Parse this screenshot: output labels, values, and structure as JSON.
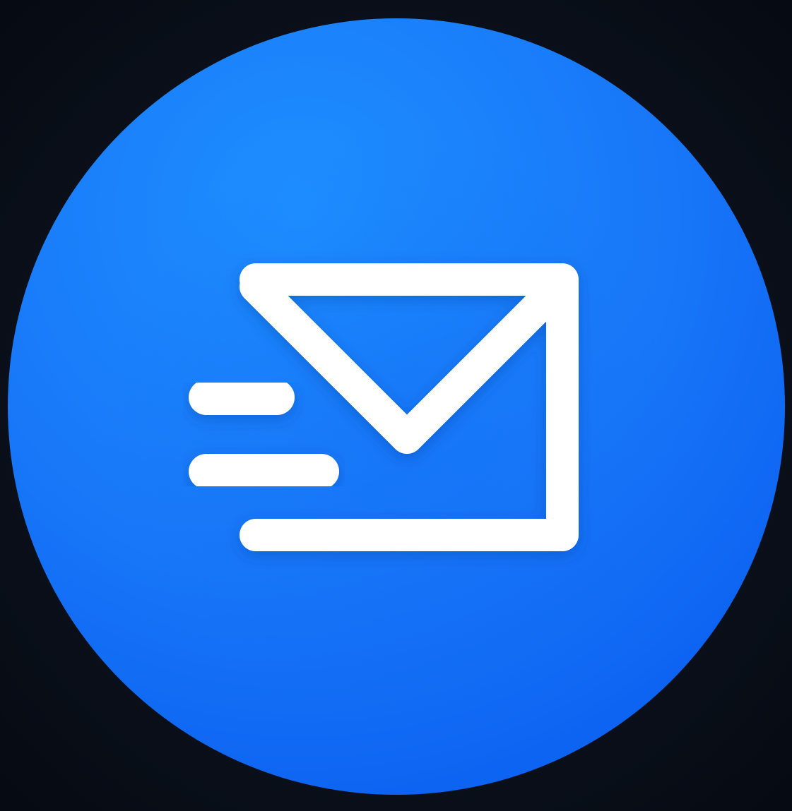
{
  "icon": {
    "name": "send-mail-icon",
    "colors": {
      "background": "#0b111c",
      "circle_light": "#1e8fff",
      "circle_mid": "#1877f8",
      "circle_dark": "#0a5ef0",
      "glyph": "#ffffff"
    }
  }
}
